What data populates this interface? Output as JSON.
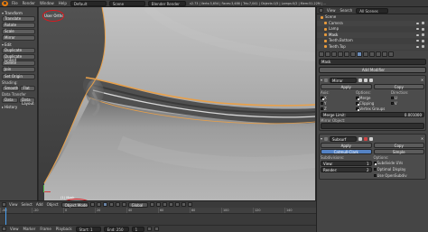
{
  "topbar": {
    "menus": [
      "File",
      "Render",
      "Window",
      "Help"
    ],
    "layout": "Default",
    "scene": "Scene",
    "engine": "Blender Render",
    "stats": "v2.73 | Verts:3,654 | Faces:3,486 | Tris:7,041 | Objects:1/5 | Lamps:0/2 | Mem:51.22M | ..."
  },
  "toolshelf": {
    "transform_label": "Transform",
    "transform_buttons": [
      "Translate",
      "Rotate",
      "Scale",
      "Mirror"
    ],
    "edit_label": "Edit",
    "edit_buttons": [
      "Duplicate",
      "Duplicate Linked",
      "Delete",
      "Join"
    ],
    "set_origin_label": "Set Origin",
    "shading_label": "Shading:",
    "shading_buttons": [
      "Smooth",
      "Flat"
    ],
    "data_transfer_label": "Data Transfer",
    "data_transfer_buttons": [
      "Data",
      "Data Layout"
    ],
    "history_label": "History"
  },
  "viewport": {
    "view_label": "User Ortho",
    "object_label": "(1) Mask"
  },
  "view_header": {
    "items": [
      "View",
      "Select",
      "Add",
      "Object"
    ],
    "mode": "Object Mode",
    "pivot": "Global"
  },
  "timeline": {
    "ticks": [
      "-40",
      "-20",
      "0",
      "20",
      "40",
      "60",
      "80",
      "100",
      "120",
      "140"
    ],
    "menus": [
      "View",
      "Marker",
      "Frame",
      "Playback"
    ],
    "start": "Start: 1",
    "end": "End: 250",
    "current": "1"
  },
  "outliner": {
    "header": [
      "View",
      "Search",
      "All Scenes"
    ],
    "rows": [
      "Scene",
      "Camera",
      "Lamp",
      "Mask",
      "Teeth.Bottom",
      "Teeth.Top"
    ]
  },
  "properties": {
    "object_name": "Mask",
    "add_modifier": "Add Modifier",
    "mirror": {
      "name": "Mirror",
      "apply": "Apply",
      "copy": "Copy",
      "axis_label": "Axis:",
      "options_label": "Options:",
      "direction_label": "Direction:",
      "axis": [
        "X",
        "Y",
        "Z"
      ],
      "options": [
        "Merge",
        "Clipping",
        "Vertex Groups"
      ],
      "direction": [
        "U",
        "V"
      ],
      "merge_limit_label": "Merge Limit:",
      "merge_limit_value": "0.001000",
      "mirror_object_label": "Mirror Object:"
    },
    "subsurf": {
      "name": "Subsurf",
      "apply": "Apply",
      "copy": "Copy",
      "type_a": "Catmull-Clark",
      "type_b": "Simple",
      "subdivisions_label": "Subdivisions:",
      "view_label": "View:",
      "view_value": "1",
      "render_label": "Render:",
      "render_value": "2",
      "options_label": "Options:",
      "options": [
        "Subdivide UVs",
        "Optimal Display",
        "Use OpenSubdiv"
      ]
    }
  },
  "colors": {
    "accent_blue": "#5583c4",
    "annotation_red": "#e0161c",
    "mesh_highlight": "#e8a04a"
  }
}
